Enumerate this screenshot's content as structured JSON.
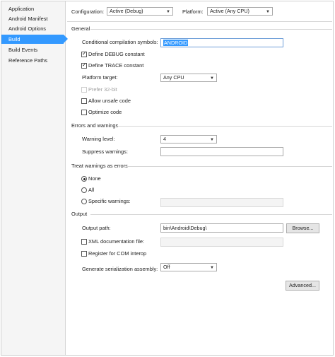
{
  "sidebar": {
    "items": [
      {
        "label": "Application"
      },
      {
        "label": "Android Manifest"
      },
      {
        "label": "Android Options"
      },
      {
        "label": "Build"
      },
      {
        "label": "Build Events"
      },
      {
        "label": "Reference Paths"
      }
    ],
    "active_index": 3
  },
  "top": {
    "configuration_label": "Configuration:",
    "configuration_value": "Active (Debug)",
    "platform_label": "Platform:",
    "platform_value": "Active (Any CPU)"
  },
  "general": {
    "heading": "General",
    "symbols_label": "Conditional compilation symbols:",
    "symbols_value": "ANDROID",
    "define_debug_label": "Define DEBUG constant",
    "define_debug_checked": true,
    "define_trace_label": "Define TRACE constant",
    "define_trace_checked": true,
    "platform_target_label": "Platform target:",
    "platform_target_value": "Any CPU",
    "prefer32_label": "Prefer 32-bit",
    "prefer32_checked": false,
    "unsafe_label": "Allow unsafe code",
    "unsafe_checked": false,
    "optimize_label": "Optimize code",
    "optimize_checked": false
  },
  "errors": {
    "heading": "Errors and warnings",
    "level_label": "Warning level:",
    "level_value": "4",
    "suppress_label": "Suppress warnings:",
    "suppress_value": ""
  },
  "treat": {
    "heading": "Treat warnings as errors",
    "none_label": "None",
    "all_label": "All",
    "specific_label": "Specific warnings:",
    "selected": "None",
    "specific_value": ""
  },
  "output": {
    "heading": "Output",
    "path_label": "Output path:",
    "path_value": "bin\\Android\\Debug\\",
    "browse_label": "Browse...",
    "xml_label": "XML documentation file:",
    "xml_checked": false,
    "xml_value": "",
    "com_label": "Register for COM interop",
    "com_checked": false,
    "serialization_label": "Generate serialization assembly:",
    "serialization_value": "Off",
    "advanced_label": "Advanced..."
  },
  "icons": {
    "dropdown": "chevron-down-icon",
    "check": "checkmark-icon"
  },
  "colors": {
    "accent": "#3399ff",
    "sidebar_bg": "#f5f5f5",
    "separator": "#d6d6d6"
  }
}
